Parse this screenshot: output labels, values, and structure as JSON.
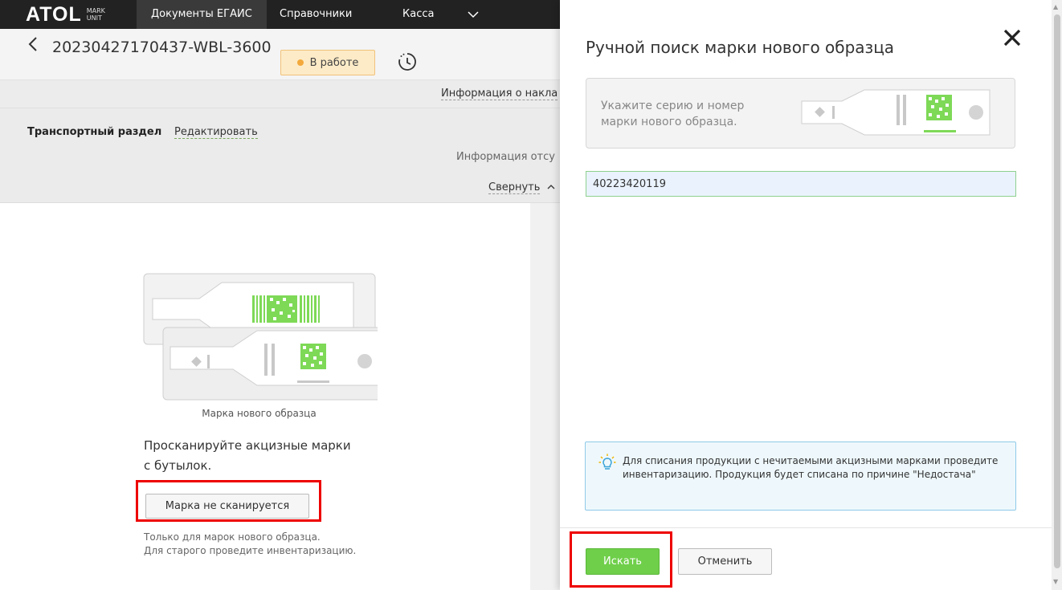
{
  "header": {
    "logo_text": "ATOL",
    "logo_sub_1": "MARK",
    "logo_sub_2": "UNIT",
    "nav": [
      "Документы ЕГАИС",
      "Справочники",
      "Касса"
    ]
  },
  "document": {
    "id": "20230427170437-WBL-3600",
    "status": "В работе",
    "info_link": "Информация о накла",
    "section_title": "Транспортный раздел",
    "edit_label": "Редактировать",
    "info_missing": "Информация отсу",
    "collapse_label": "Свернуть"
  },
  "scan": {
    "caption": "Марка нового образца",
    "instruction": "Просканируйте акцизные марки с бутылок.",
    "not_scanning_button": "Марка не сканируется",
    "hint_line1": "Только для марок нового образца.",
    "hint_line2": "Для старого проведите инвентаризацию."
  },
  "panel": {
    "title": "Ручной поиск марки нового образца",
    "card_text": "Укажите серию и номер марки нового образца.",
    "input_value": "40223420119",
    "notice": "Для списания продукции с нечитаемыми акцизными марками проведите инвентаризацию. Продукция будет списана по причине \"Недостача\"",
    "search_button": "Искать",
    "cancel_button": "Отменить"
  },
  "colors": {
    "topbar": "#222222",
    "accent_green": "#6fcf4a",
    "status_orange": "#f3a93c",
    "highlight_red": "#ee0000",
    "notice_border": "#8fcae8"
  },
  "icons": [
    "back-icon",
    "history-icon",
    "chevron-down-icon",
    "close-icon",
    "bulb-icon",
    "chevron-up-icon"
  ]
}
